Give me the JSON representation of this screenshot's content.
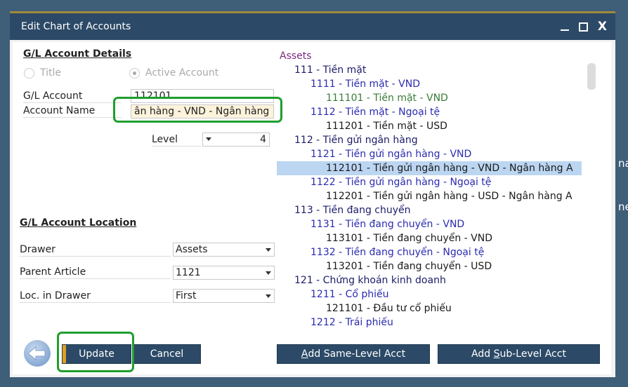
{
  "window": {
    "title": "Edit Chart of Accounts",
    "controls": [
      "minimize",
      "maximize",
      "close"
    ],
    "close_glyph": "X"
  },
  "details": {
    "section_title": "G/L Account Details",
    "radio_title": "Title",
    "radio_active": "Active Account",
    "radio_selected": "Active Account",
    "gl_account_label": "G/L Account",
    "gl_account_value": "112101",
    "account_name_label": "Account Name",
    "account_name_value": "ân hàng - VND - Ngân hàng",
    "level_label": "Level",
    "level_value": "4"
  },
  "location": {
    "section_title": "G/L Account Location",
    "drawer_label": "Drawer",
    "drawer_value": "Assets",
    "parent_label": "Parent Article",
    "parent_value": "1121",
    "loc_label": "Loc. in Drawer",
    "loc_value": "First"
  },
  "tree": {
    "items": [
      {
        "level": 0,
        "label": "Assets"
      },
      {
        "level": 1,
        "label": "111 - Tiền mặt"
      },
      {
        "level": 2,
        "label": "1111 - Tiền mặt - VND"
      },
      {
        "level": 3,
        "label": "111101 - Tiền mặt - VND",
        "style": "green"
      },
      {
        "level": 2,
        "label": "1112 - Tiền mặt - Ngoại tệ"
      },
      {
        "level": 3,
        "label": "111201 - Tiền mặt - USD"
      },
      {
        "level": 1,
        "label": "112 - Tiền gửi ngân hàng"
      },
      {
        "level": 2,
        "label": "1121 - Tiền gửi ngân hàng - VND"
      },
      {
        "level": 3,
        "label": "112101 - Tiền gửi ngân hàng - VND - Ngân hàng A",
        "selected": true
      },
      {
        "level": 2,
        "label": "1122 - Tiền gửi ngân hàng - Ngoại tệ"
      },
      {
        "level": 3,
        "label": "112201 - Tiền gửi ngân hàng - USD - Ngân hàng A"
      },
      {
        "level": 1,
        "label": "113 - Tiền đang chuyển"
      },
      {
        "level": 2,
        "label": "1131 - Tiền đang chuyển - VND"
      },
      {
        "level": 3,
        "label": "113101 - Tiền đang chuyển - VND"
      },
      {
        "level": 2,
        "label": "1132 - Tiền đang chuyển - Ngoại tệ"
      },
      {
        "level": 3,
        "label": "113201 - Tiền đang chuyển - USD"
      },
      {
        "level": 1,
        "label": "121 - Chứng khoán kinh doanh"
      },
      {
        "level": 2,
        "label": "1211 - Cổ phiếu"
      },
      {
        "level": 3,
        "label": "121101 - Đầu tư cổ phiếu"
      },
      {
        "level": 2,
        "label": "1212 - Trái phiếu"
      }
    ]
  },
  "buttons": {
    "update": "Update",
    "cancel": "Cancel",
    "add_same_prefix": "A",
    "add_same_rest": "dd Same-Level Acct",
    "add_sub_prefix": "Add ",
    "add_sub_key": "S",
    "add_sub_rest": "ub-Level Acct"
  },
  "background": {
    "fragment_1": "na",
    "fragment_2": "ne"
  },
  "colors": {
    "titlebar": "#2c4a67",
    "highlight": "#1e9e2e",
    "selection": "#bcd6f2",
    "accent": "#e0a020"
  }
}
